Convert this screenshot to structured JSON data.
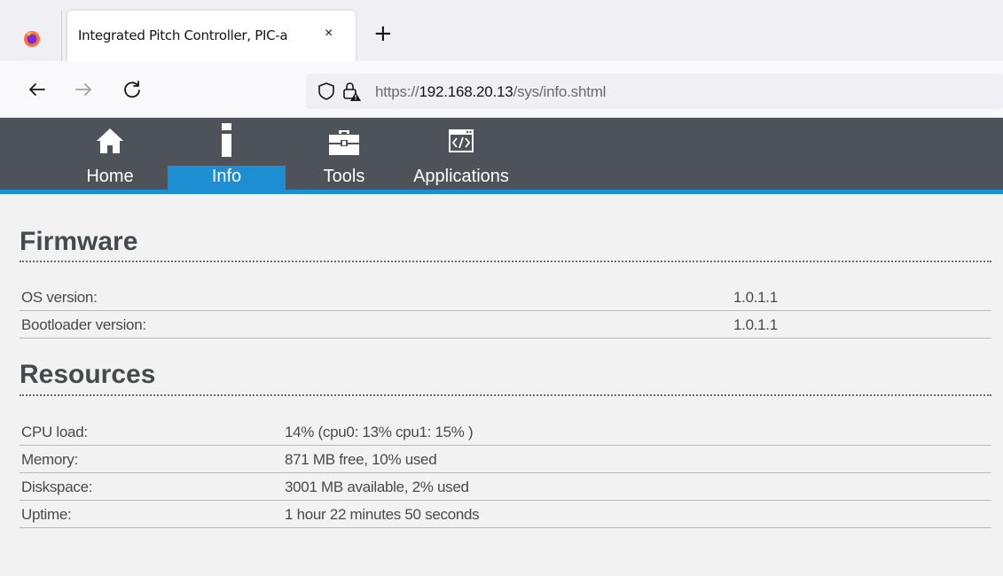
{
  "browser": {
    "tab_title": "Integrated Pitch Controller, PIC-a",
    "tab_close": "×",
    "new_tab": "+",
    "url_prefix": "https://",
    "url_host": "192.168.20.13",
    "url_path": "/sys/info.shtml"
  },
  "menu": {
    "items": [
      {
        "label": "Home",
        "icon": "home-icon"
      },
      {
        "label": "Info",
        "icon": "info-icon",
        "active": true
      },
      {
        "label": "Tools",
        "icon": "toolbox-icon"
      },
      {
        "label": "Applications",
        "icon": "code-window-icon"
      }
    ],
    "active_color": "#1d8ed2",
    "bar_color": "#4e5359"
  },
  "firmware": {
    "title": "Firmware",
    "rows": [
      {
        "label": "OS version:",
        "value": "1.0.1.1"
      },
      {
        "label": "Bootloader version:",
        "value": "1.0.1.1"
      }
    ]
  },
  "resources": {
    "title": "Resources",
    "rows": [
      {
        "label": "CPU load:",
        "value": "14% (cpu0: 13% cpu1: 15% )"
      },
      {
        "label": "Memory:",
        "value": "871 MB free, 10% used"
      },
      {
        "label": "Diskspace:",
        "value": "3001 MB available, 2% used"
      },
      {
        "label": "Uptime:",
        "value": "1 hour 22 minutes 50 seconds"
      }
    ]
  }
}
